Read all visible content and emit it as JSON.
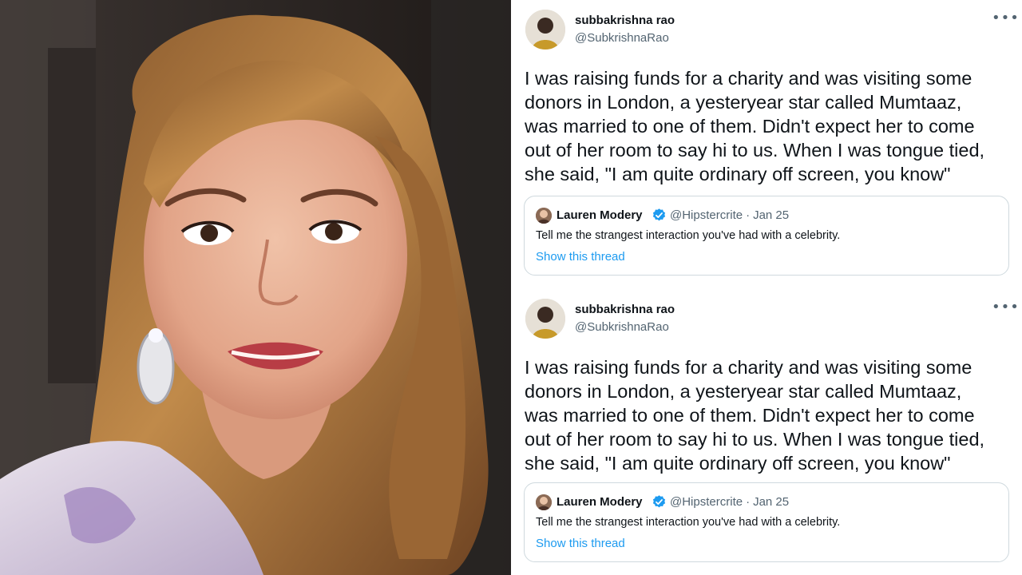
{
  "tweets": [
    {
      "author_name": "subbakrishna rao",
      "author_handle": "@SubkrishnaRao",
      "more_icon": "more-icon",
      "text": "I was raising funds for a charity and was visiting some\ndonors in London, a yesteryear star called Mumtaaz,\nwas married to one of them. Didn't expect her to come\nout of her room to say hi to us. When I was tongue tied,\nshe said, \"I am quite ordinary off screen, you know\"",
      "quoted": {
        "author_name": "Lauren Modery",
        "author_handle": "@Hipstercrite",
        "separator": "·",
        "date": "Jan 25",
        "text": "Tell me the strangest interaction you've had with a celebrity.",
        "link_label": "Show this thread"
      }
    },
    {
      "author_name": "subbakrishna rao",
      "author_handle": "@SubkrishnaRao",
      "more_icon": "more-icon",
      "text": "I was raising funds for a charity and was visiting some\ndonors in London, a yesteryear star called Mumtaaz,\nwas married to one of them. Didn't expect her to come\nout of her room to say hi to us. When I was tongue tied,\nshe said, \"I am quite ordinary off screen, you know\"",
      "quoted": {
        "author_name": "Lauren Modery",
        "author_handle": "@Hipstercrite",
        "separator": "·",
        "date": "Jan 25",
        "text": "Tell me the strangest interaction you've had with a celebrity.",
        "link_label": "Show this thread"
      }
    }
  ],
  "colors": {
    "link": "#1d9bf0",
    "secondary_text": "#536471",
    "border": "#cfd9de",
    "verified_badge": "#1d9bf0"
  }
}
